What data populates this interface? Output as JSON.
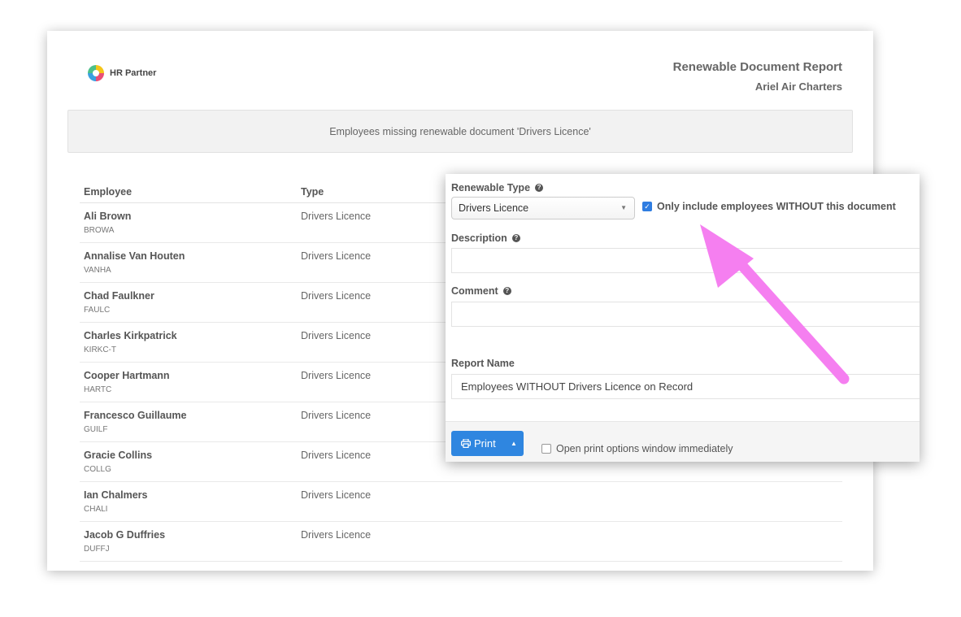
{
  "logo": {
    "text": "HR Partner"
  },
  "report": {
    "title": "Renewable Document Report",
    "company": "Ariel Air Charters"
  },
  "banner": {
    "text": "Employees missing renewable document 'Drivers Licence'"
  },
  "table": {
    "headers": {
      "employee": "Employee",
      "type": "Type"
    },
    "rows": [
      {
        "name": "Ali Brown",
        "code": "BROWA",
        "type": "Drivers Licence"
      },
      {
        "name": "Annalise Van Houten",
        "code": "VANHA",
        "type": "Drivers Licence"
      },
      {
        "name": "Chad Faulkner",
        "code": "FAULC",
        "type": "Drivers Licence"
      },
      {
        "name": "Charles Kirkpatrick",
        "code": "KIRKC-T",
        "type": "Drivers Licence"
      },
      {
        "name": "Cooper Hartmann",
        "code": "HARTC",
        "type": "Drivers Licence"
      },
      {
        "name": "Francesco Guillaume",
        "code": "GUILF",
        "type": "Drivers Licence"
      },
      {
        "name": "Gracie Collins",
        "code": "COLLG",
        "type": "Drivers Licence"
      },
      {
        "name": "Ian Chalmers",
        "code": "CHALI",
        "type": "Drivers Licence"
      },
      {
        "name": "Jacob G Duffries",
        "code": "DUFFJ",
        "type": "Drivers Licence"
      }
    ]
  },
  "panel": {
    "renewable_type_label": "Renewable Type",
    "renewable_type_value": "Drivers Licence",
    "only_without_label": "Only include employees WITHOUT this document",
    "only_without_checked": true,
    "description_label": "Description",
    "description_value": "",
    "comment_label": "Comment",
    "comment_value": "",
    "report_name_label": "Report Name",
    "report_name_value": "Employees WITHOUT Drivers Licence on Record",
    "print_label": "Print",
    "open_print_label": "Open print options window immediately",
    "open_print_checked": false
  },
  "colors": {
    "accent": "#2f86e0",
    "checkbox": "#2f7de1",
    "annotation_arrow": "#f57ff0"
  }
}
